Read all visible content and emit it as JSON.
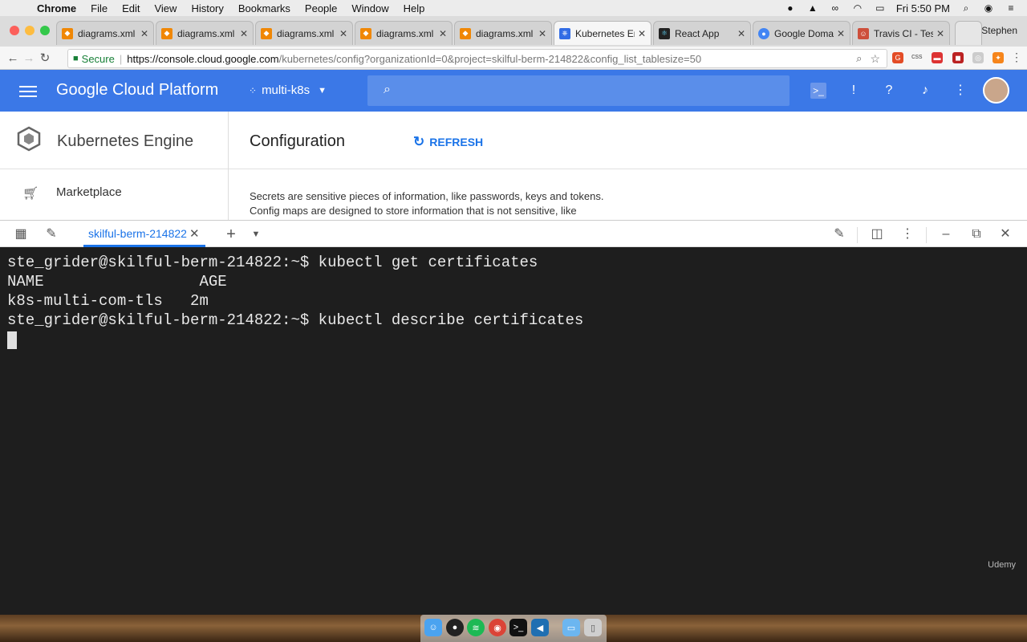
{
  "menubar": {
    "app": "Chrome",
    "items": [
      "File",
      "Edit",
      "View",
      "History",
      "Bookmarks",
      "People",
      "Window",
      "Help"
    ],
    "clock": "Fri 5:50 PM"
  },
  "tabs": [
    {
      "label": "diagrams.xml -",
      "favicon_color": "#f08705"
    },
    {
      "label": "diagrams.xml -",
      "favicon_color": "#f08705"
    },
    {
      "label": "diagrams.xml -",
      "favicon_color": "#f08705"
    },
    {
      "label": "diagrams.xml -",
      "favicon_color": "#f08705"
    },
    {
      "label": "diagrams.xml -",
      "favicon_color": "#f08705"
    },
    {
      "label": "Kubernetes En",
      "favicon_color": "#326ce5",
      "active": true
    },
    {
      "label": "React App",
      "favicon_color": "#222222"
    },
    {
      "label": "Google Domain",
      "favicon_color": "#4285f4"
    },
    {
      "label": "Travis CI - Test",
      "favicon_color": "#cd4f3b"
    }
  ],
  "profile_name": "Stephen",
  "addressbar": {
    "secure_label": "Secure",
    "url_host": "https://console.cloud.google.com",
    "url_path": "/kubernetes/config?organizationId=0&project=skilful-berm-214822&config_list_tablesize=50",
    "ext_css_label": "css"
  },
  "gcp": {
    "title": "Google Cloud Platform",
    "project": "multi-k8s",
    "brand_color": "#3b78e7"
  },
  "leftnav": {
    "product": "Kubernetes Engine",
    "marketplace": "Marketplace"
  },
  "main": {
    "title": "Configuration",
    "refresh": "REFRESH",
    "desc_line1": "Secrets are sensitive pieces of information, like passwords, keys and tokens.",
    "desc_line2": "Config maps are designed to store information that is not sensitive, like"
  },
  "shell": {
    "tab_label": "skilful-berm-214822"
  },
  "terminal": {
    "lines": [
      "ste_grider@skilful-berm-214822:~$ kubectl get certificates",
      "NAME                 AGE",
      "k8s-multi-com-tls   2m",
      "ste_grider@skilful-berm-214822:~$ kubectl describe certificates"
    ]
  },
  "watermark": "Udemy"
}
